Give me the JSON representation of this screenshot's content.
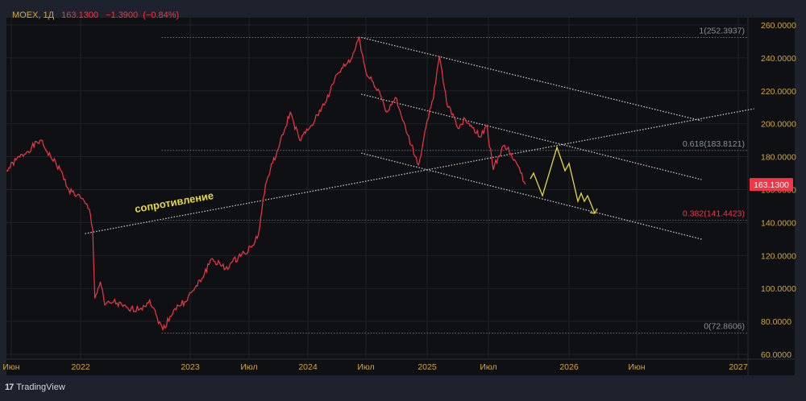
{
  "header": {
    "symbol": "MOEX, 1Д",
    "price": "163.1300",
    "change": "−1.3900",
    "change_pct": "(−0.84%)"
  },
  "branding": {
    "logo_text": "TradingView"
  },
  "colors": {
    "price_line": "#f23645",
    "forecast": "#e8d93a",
    "axis_text": "#d4a63a",
    "bg": "#0f1014"
  },
  "chart_data": {
    "type": "line",
    "title": "MOEX, 1Д",
    "ylim": [
      60,
      260
    ],
    "y_ticks": [
      "260.0000",
      "240.0000",
      "220.0000",
      "200.0000",
      "180.0000",
      "160.0000",
      "140.0000",
      "120.0000",
      "100.0000",
      "80.0000",
      "60.0000"
    ],
    "y_tick_values": [
      260,
      240,
      220,
      200,
      180,
      160,
      140,
      120,
      100,
      80,
      60
    ],
    "x_ticks": [
      {
        "label": "Июн",
        "t": 2021.42
      },
      {
        "label": "2022",
        "t": 2022.0
      },
      {
        "label": "2023",
        "t": 2023.0
      },
      {
        "label": "Июл",
        "t": 2023.5
      },
      {
        "label": "2024",
        "t": 2024.0
      },
      {
        "label": "Июл",
        "t": 2024.5
      },
      {
        "label": "2025",
        "t": 2025.0
      },
      {
        "label": "Июл",
        "t": 2025.5
      },
      {
        "label": "2026",
        "t": 2026.0
      },
      {
        "label": "Июн",
        "t": 2026.42
      },
      {
        "label": "2027",
        "t": 2027.0
      }
    ],
    "series": [
      {
        "name": "MOEX",
        "points": [
          [
            2021.38,
            171.5
          ],
          [
            2021.46,
            178
          ],
          [
            2021.55,
            183
          ],
          [
            2021.66,
            190
          ],
          [
            2021.75,
            180
          ],
          [
            2021.83,
            172
          ],
          [
            2021.9,
            160
          ],
          [
            2022.0,
            155
          ],
          [
            2022.08,
            148
          ],
          [
            2022.11,
            136
          ],
          [
            2022.13,
            94
          ],
          [
            2022.18,
            104
          ],
          [
            2022.22,
            90
          ],
          [
            2022.3,
            92
          ],
          [
            2022.44,
            87
          ],
          [
            2022.55,
            88
          ],
          [
            2022.63,
            93
          ],
          [
            2022.7,
            82
          ],
          [
            2022.75,
            75
          ],
          [
            2022.85,
            87
          ],
          [
            2022.95,
            92
          ],
          [
            2023.03,
            99
          ],
          [
            2023.1,
            106
          ],
          [
            2023.18,
            118
          ],
          [
            2023.3,
            112
          ],
          [
            2023.44,
            121
          ],
          [
            2023.52,
            125
          ],
          [
            2023.58,
            133
          ],
          [
            2023.64,
            163
          ],
          [
            2023.7,
            176
          ],
          [
            2023.75,
            185
          ],
          [
            2023.8,
            196
          ],
          [
            2023.85,
            207
          ],
          [
            2023.93,
            190
          ],
          [
            2024.0,
            196
          ],
          [
            2024.06,
            202
          ],
          [
            2024.12,
            210
          ],
          [
            2024.19,
            219
          ],
          [
            2024.25,
            230
          ],
          [
            2024.3,
            234
          ],
          [
            2024.38,
            240
          ],
          [
            2024.44,
            253
          ],
          [
            2024.48,
            238
          ],
          [
            2024.51,
            229
          ],
          [
            2024.55,
            226
          ],
          [
            2024.6,
            221
          ],
          [
            2024.67,
            207
          ],
          [
            2024.74,
            216
          ],
          [
            2024.8,
            202
          ],
          [
            2024.87,
            187
          ],
          [
            2024.93,
            175
          ],
          [
            2024.97,
            190
          ],
          [
            2025.0,
            202
          ],
          [
            2025.05,
            215
          ],
          [
            2025.1,
            241
          ],
          [
            2025.16,
            212
          ],
          [
            2025.21,
            206
          ],
          [
            2025.26,
            197
          ],
          [
            2025.31,
            203
          ],
          [
            2025.36,
            199
          ],
          [
            2025.43,
            192
          ],
          [
            2025.49,
            199
          ],
          [
            2025.53,
            172
          ],
          [
            2025.56,
            180
          ],
          [
            2025.6,
            187
          ],
          [
            2025.64,
            182
          ],
          [
            2025.67,
            177
          ],
          [
            2025.7,
            170
          ],
          [
            2025.73,
            163.13
          ]
        ]
      },
      {
        "name": "forecast",
        "points": [
          [
            2025.76,
            166.6
          ],
          [
            2025.78,
            170
          ],
          [
            2025.835,
            156.3
          ],
          [
            2025.925,
            185.7
          ],
          [
            2025.975,
            171.5
          ],
          [
            2026.0,
            175.9
          ],
          [
            2026.055,
            152.9
          ],
          [
            2026.075,
            157.8
          ],
          [
            2026.095,
            152.9
          ],
          [
            2026.115,
            156.3
          ],
          [
            2026.16,
            145.6
          ]
        ]
      }
    ],
    "trendlines": [
      {
        "name": "resistance",
        "from": [
          2022.04,
          133.3
        ],
        "to": [
          2027.09,
          209.1
        ]
      },
      {
        "name": "channel-top",
        "from": [
          2024.46,
          252.4
        ],
        "to": [
          2026.79,
          201.8
        ]
      },
      {
        "name": "channel-mid",
        "from": [
          2024.46,
          218
        ],
        "to": [
          2026.79,
          166.1
        ]
      },
      {
        "name": "channel-bottom",
        "from": [
          2024.46,
          182.2
        ],
        "to": [
          2026.79,
          129.9
        ]
      }
    ],
    "fib_levels": [
      {
        "label": "1(252.3937)",
        "value": 252.3937,
        "color": "#8a8e99"
      },
      {
        "label": "0.618(183.8121)",
        "value": 183.8121,
        "color": "#8a8e99"
      },
      {
        "label": "0.382(141.4423)",
        "value": 141.4423,
        "color": "#f23645"
      },
      {
        "label": "0(72.8606)",
        "value": 72.8606,
        "color": "#8a8e99"
      }
    ],
    "fib_start": 2022.74,
    "annotation": {
      "text": "сопротивление",
      "t": 2022.5,
      "price": 146
    },
    "last_price_label": "163.1300",
    "last_price": 163.13
  }
}
